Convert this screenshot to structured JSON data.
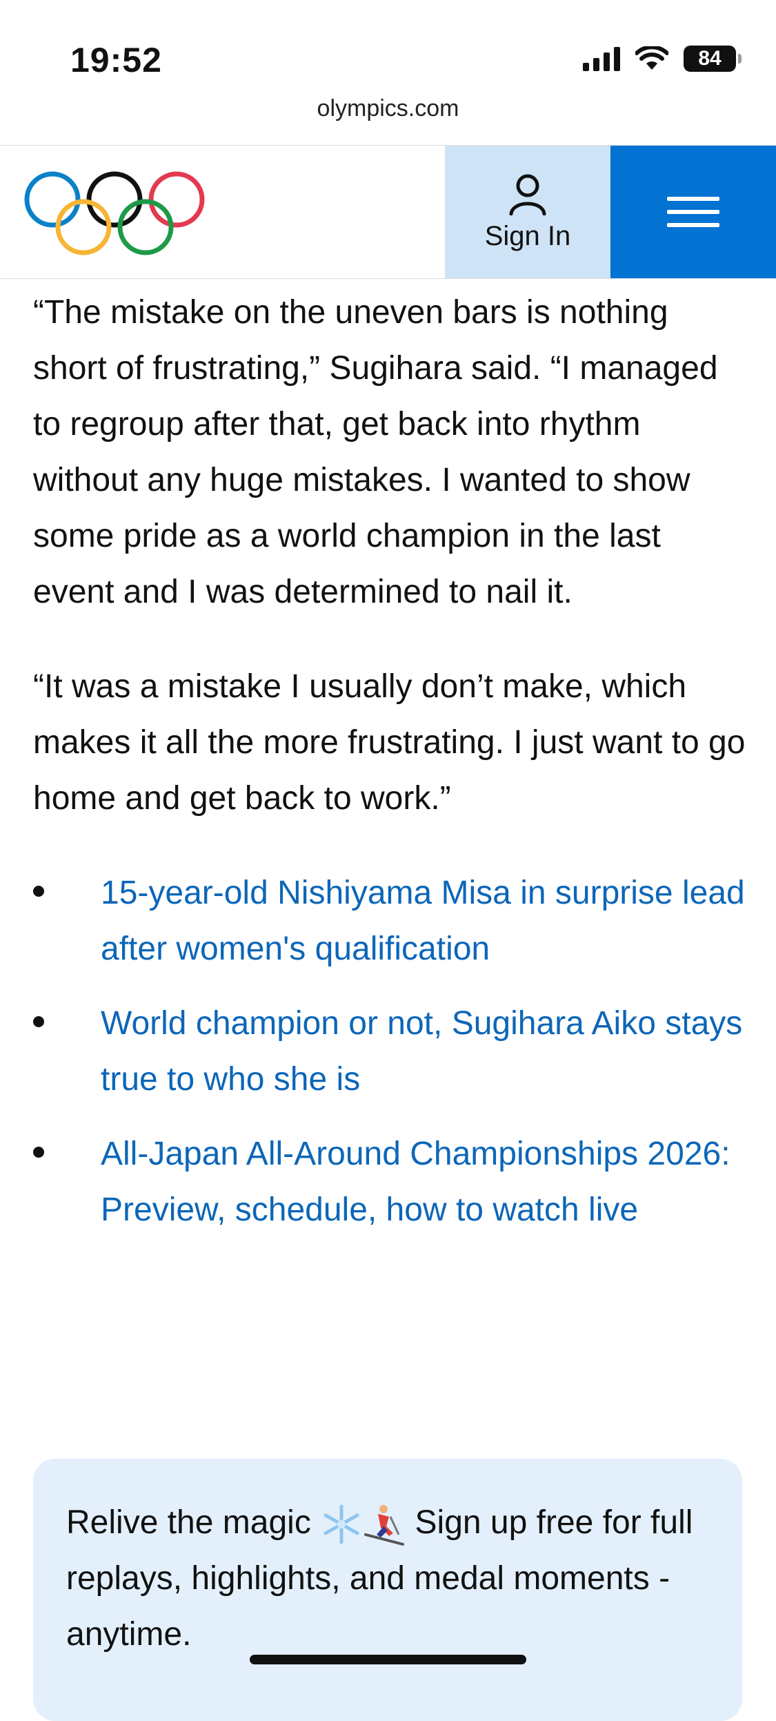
{
  "status_bar": {
    "time": "19:52",
    "battery": "84",
    "url": "olympics.com"
  },
  "header": {
    "logo_icon": "olympic-rings",
    "sign_in_label": "Sign In",
    "menu_icon": "hamburger-menu-icon",
    "colors": {
      "signin_bg": "#cfe3f6",
      "menu_bg": "#0272d3"
    }
  },
  "article": {
    "paragraphs": [
      "“The mistake on the uneven bars is nothing short of frustrating,” Sugihara said. “I managed to regroup after that, get back into rhythm without any huge mistakes. I wanted to show some pride as a world champion in the last event and I was determined to nail it.",
      "“It was a mistake I usually don’t make, which makes it all the more frustrating. I just want to go home and get back to work.”"
    ],
    "related_links": [
      "15-year-old Nishiyama Misa in surprise lead after women's qualification",
      "World champion or not, Sugihara Aiko stays true to who she is",
      "All-Japan All-Around Championships 2026: Preview, schedule, how to watch live"
    ],
    "link_color": "#0c66b8"
  },
  "promo": {
    "text_before": "Relive the magic",
    "emojis": [
      "snowflake-icon",
      "skier-icon"
    ],
    "text_after": "Sign up free for full replays, highlights, and medal moments - anytime.",
    "bg_color": "#e3f0fb"
  }
}
